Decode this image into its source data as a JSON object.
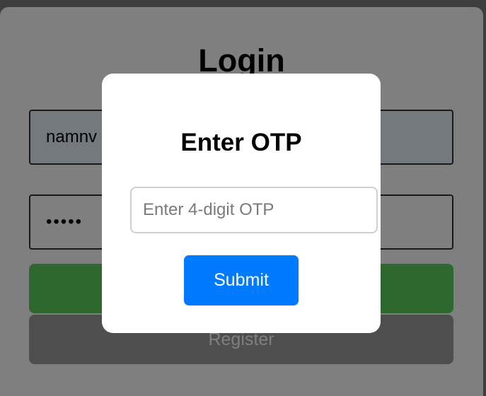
{
  "login": {
    "title": "Login",
    "username_value": "namnv",
    "password_value": "•••••",
    "login_button_label": "",
    "register_button_label": "Register"
  },
  "otp_modal": {
    "title": "Enter OTP",
    "input_placeholder": "Enter 4-digit OTP",
    "submit_label": "Submit"
  },
  "colors": {
    "overlay": "rgba(0,0,0,0.5)",
    "submit": "#007bff",
    "login_button": "#5cd05c",
    "register_button": "#9c9c9c"
  }
}
